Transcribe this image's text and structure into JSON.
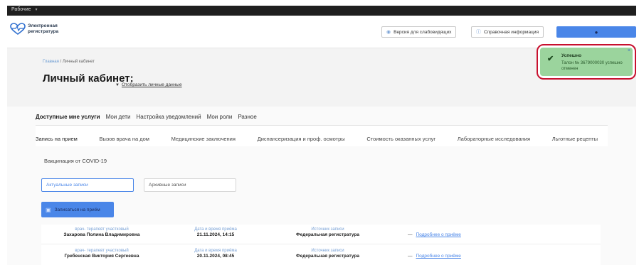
{
  "topbar": {
    "workspace": "Рабочие",
    "chevron": "▾"
  },
  "header": {
    "logo_line1": "Электронная",
    "logo_line2": "регистратура",
    "btn_impaired": "Версия для слабовидящих",
    "btn_info": "Справочная информация",
    "btn_account_icon": "user-icon"
  },
  "breadcrumb": {
    "home": "Главная",
    "separator": "/",
    "current": "Личный кабинет"
  },
  "page_title": "Личный кабинет:",
  "show_personal": "Отобразить личные данные",
  "toast": {
    "title": "Успешно",
    "message": "Талон № 3679000030 успешно отменен",
    "close": "×"
  },
  "tabs_primary": [
    {
      "label": "Доступные мне услуги",
      "active": true
    },
    {
      "label": "Мои дети",
      "active": false
    },
    {
      "label": "Настройка уведомлений",
      "active": false
    },
    {
      "label": "Мои роли",
      "active": false
    },
    {
      "label": "Разное",
      "active": false
    }
  ],
  "tabs_secondary": [
    {
      "label": "Запись на прием",
      "active": true
    },
    {
      "label": "Вызов врача на дом",
      "active": false
    },
    {
      "label": "Медицинские заключения",
      "active": false
    },
    {
      "label": "Диспансеризация и проф. осмотры",
      "active": false
    },
    {
      "label": "Стоимость оказанных услуг",
      "active": false
    },
    {
      "label": "Лабораторные исследования",
      "active": false
    },
    {
      "label": "Льготные рецепты",
      "active": false
    }
  ],
  "vaccination_tab": "Вакцинация от COVID-19",
  "filters": {
    "active": "Актуальные записи",
    "archive": "Архивные записи"
  },
  "book_button": "Записаться на приём",
  "appointments": [
    {
      "doctor_label": "врач- терапевт участковый",
      "doctor_name": "Захарова Полина Владимировна",
      "datetime_label": "Дата и время приёма",
      "datetime": "21.11.2024, 14:15",
      "source_label": "Источник записи",
      "source": "Федеральная регистратура",
      "details": "Подробнее о приёме"
    },
    {
      "doctor_label": "врач- терапевт участковый",
      "doctor_name": "Гребенская Виктория Сергеевна",
      "datetime_label": "Дата и время приёма",
      "datetime": "20.11.2024, 08:45",
      "source_label": "Источник записи",
      "source": "Федеральная регистратура",
      "details": "Подробнее о приёме"
    }
  ]
}
